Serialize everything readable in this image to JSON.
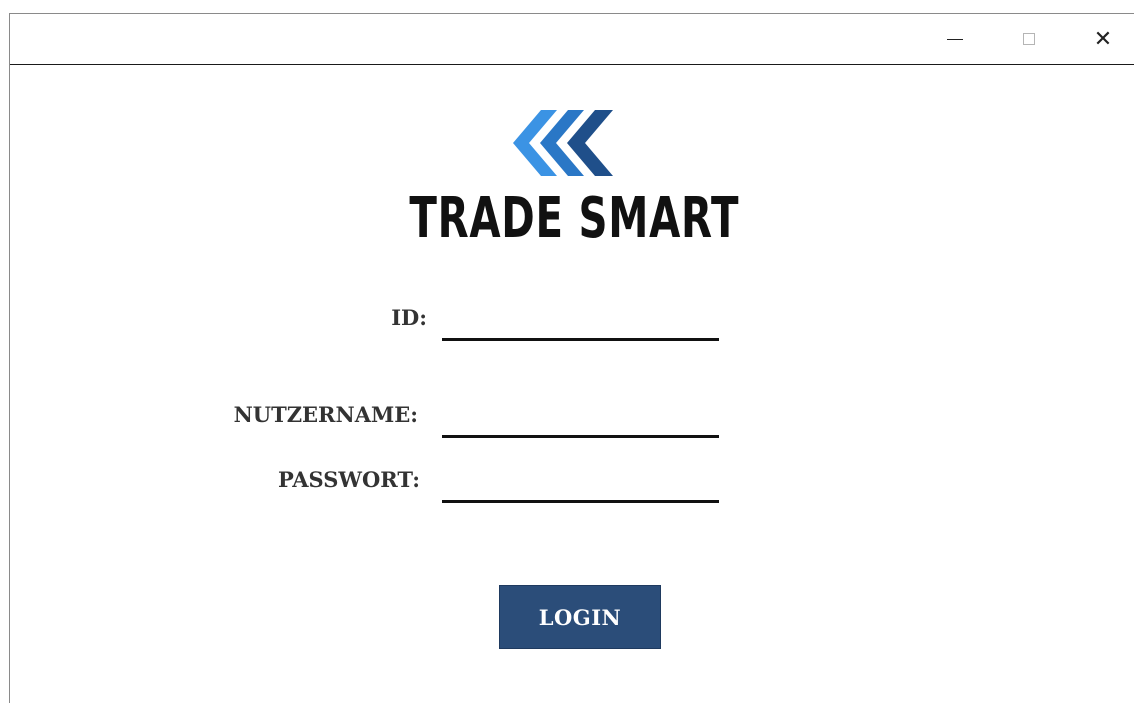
{
  "window": {
    "title_bar": {
      "minimize_icon": "minimize-icon",
      "maximize_icon": "maximize-icon",
      "close_icon": "close-icon",
      "close_glyph": "✕"
    }
  },
  "brand": {
    "logo_icon": "triple-chevron-left-icon",
    "name": "TRADE SMART",
    "colors": {
      "chevron_light": "#3b93e4",
      "chevron_mid": "#2a77c6",
      "chevron_dark": "#1f4f8a"
    }
  },
  "form": {
    "id_label": "ID:",
    "id_value": "",
    "username_label": "NUTZERNAME:",
    "username_value": "",
    "password_label": "PASSWORT:",
    "password_value": "",
    "login_label": "LOGIN",
    "login_color": "#2b4d79"
  }
}
